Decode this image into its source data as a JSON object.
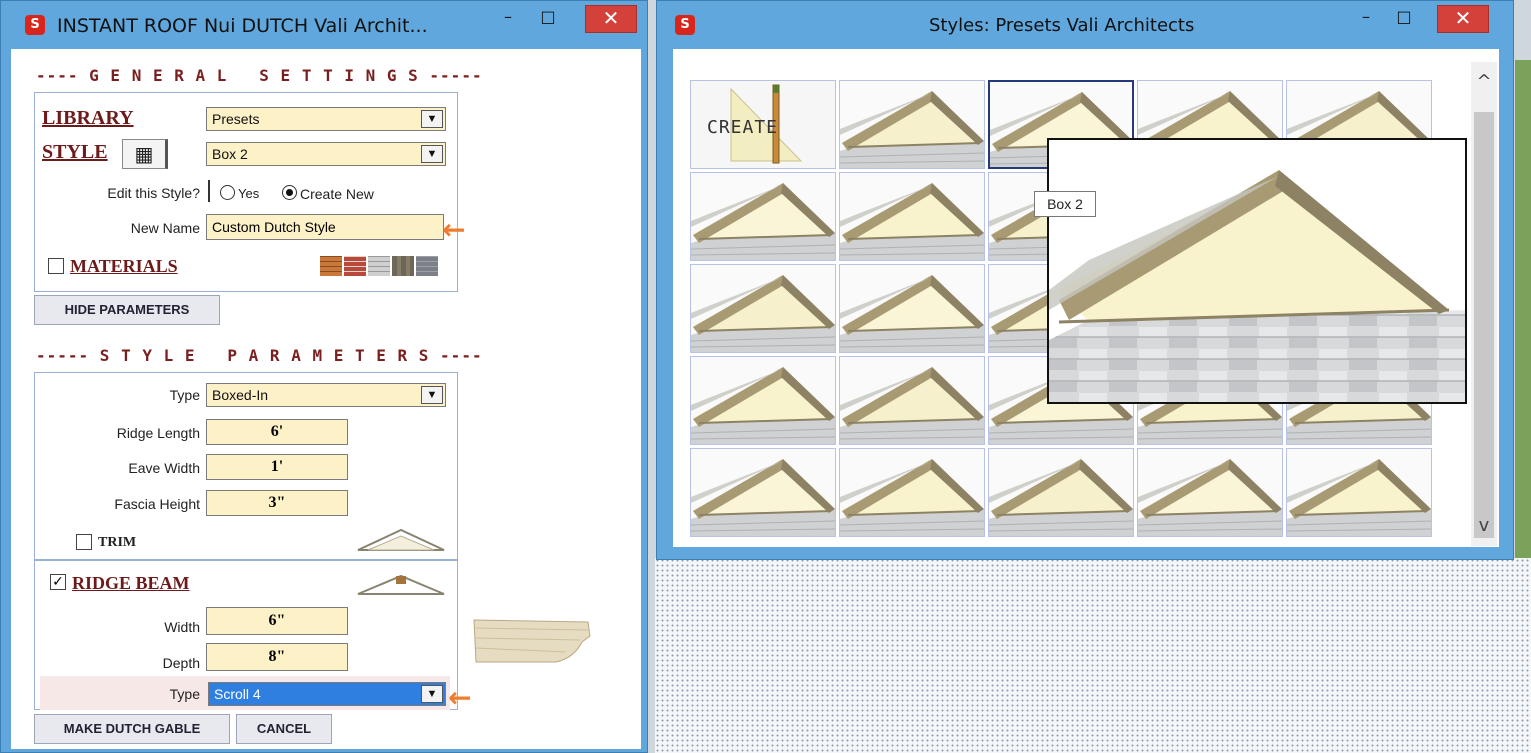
{
  "left_window": {
    "title": "INSTANT ROOF Nui DUTCH   Vali Archit...",
    "minimize": "–",
    "maximize": "□",
    "close": "✕",
    "general_settings": "---- G E N E R A L   S E T T I N G S -----",
    "library_label": "LIBRARY",
    "library_value": "Presets",
    "style_label": "STYLE",
    "style_value": "Box 2",
    "edit_style_label": "Edit this Style?",
    "radio_yes": "Yes",
    "radio_create": "Create New",
    "radio_selected": "Create New",
    "new_name_label": "New Name",
    "new_name_value": "Custom Dutch Style",
    "materials_label": "MATERIALS",
    "materials_checked": false,
    "hide_parameters": "HIDE PARAMETERS",
    "style_parameters": "----- S T Y L E   P A R A M E T E R S ----",
    "type_label": "Type",
    "type_value": "Boxed-In",
    "ridge_length_label": "Ridge Length",
    "ridge_length_value": "6'",
    "eave_width_label": "Eave Width",
    "eave_width_value": "1'",
    "fascia_height_label": "Fascia Height",
    "fascia_height_value": "3\"",
    "trim_label": "TRIM",
    "trim_checked": false,
    "ridge_beam_label": "RIDGE BEAM",
    "ridge_beam_checked": true,
    "width_label": "Width",
    "width_value": "6\"",
    "depth_label": "Depth",
    "depth_value": "8\"",
    "beam_type_label": "Type",
    "beam_type_value": "Scroll 4",
    "make_button": "MAKE DUTCH GABLE",
    "cancel_button": "CANCEL",
    "checkmark": "✓",
    "grid_glyph": "▦",
    "dropdown_glyph": "▼",
    "arrow_glyph": "←"
  },
  "right_window": {
    "title": "Styles: Presets   Vali Architects",
    "minimize": "–",
    "maximize": "□",
    "close": "✕",
    "create_tile": "CREATE",
    "tooltip": "Box 2",
    "scroll_up": "^",
    "scroll_down": "v",
    "rows": 5,
    "cols": 5,
    "selected_index": 2
  },
  "colors": {
    "titlebar": "#5fa7dd",
    "section_text": "#7a1f1f",
    "field_bg": "#fdf1c8",
    "orange_arrow": "#f07d2e",
    "selection_blue": "#2f7fe0"
  }
}
